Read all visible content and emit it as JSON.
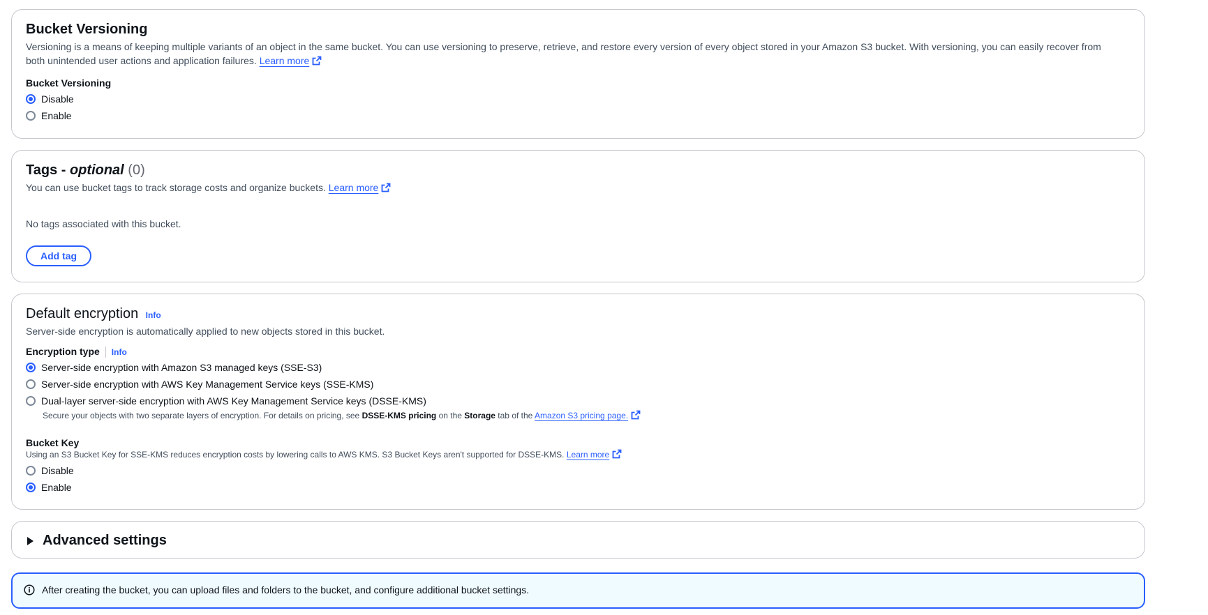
{
  "colors": {
    "accent": "#295eff",
    "border": "#c6c6cd",
    "info_bg": "#f0fbff"
  },
  "versioning": {
    "title": "Bucket Versioning",
    "description_line1": "Versioning is a means of keeping multiple variants of an object in the same bucket. You can use versioning to preserve, retrieve, and restore every version of every object stored in your Amazon S3 bucket. With versioning, you can easily recover from",
    "description_line2": "both unintended user actions and application failures.",
    "learn_more": "Learn more",
    "field_label": "Bucket Versioning",
    "options": [
      {
        "label": "Disable",
        "selected": true
      },
      {
        "label": "Enable",
        "selected": false
      }
    ]
  },
  "tags": {
    "title_prefix": "Tags - ",
    "title_optional": "optional",
    "count": "(0)",
    "description": "You can use bucket tags to track storage costs and organize buckets.",
    "learn_more": "Learn more",
    "empty_text": "No tags associated with this bucket.",
    "add_button": "Add tag"
  },
  "encryption": {
    "title": "Default encryption",
    "info": "Info",
    "description": "Server-side encryption is automatically applied to new objects stored in this bucket.",
    "type_label": "Encryption type",
    "type_info": "Info",
    "options": [
      {
        "label": "Server-side encryption with Amazon S3 managed keys (SSE-S3)",
        "selected": true
      },
      {
        "label": "Server-side encryption with AWS Key Management Service keys (SSE-KMS)",
        "selected": false
      },
      {
        "label": "Dual-layer server-side encryption with AWS Key Management Service keys (DSSE-KMS)",
        "selected": false
      }
    ],
    "dsse_note_1": "Secure your objects with two separate layers of encryption. For details on pricing, see ",
    "dsse_note_bold1": "DSSE-KMS pricing",
    "dsse_note_2": " on the ",
    "dsse_note_bold2": "Storage",
    "dsse_note_3": " tab of the ",
    "dsse_note_link": "Amazon S3 pricing page.",
    "bucket_key_label": "Bucket Key",
    "bucket_key_desc": "Using an S3 Bucket Key for SSE-KMS reduces encryption costs by lowering calls to AWS KMS. S3 Bucket Keys aren't supported for DSSE-KMS.",
    "bucket_key_learn_more": "Learn more",
    "bucket_key_options": [
      {
        "label": "Disable",
        "selected": false
      },
      {
        "label": "Enable",
        "selected": true
      }
    ]
  },
  "advanced": {
    "title": "Advanced settings",
    "expanded": false
  },
  "alert": {
    "text": "After creating the bucket, you can upload files and folders to the bucket, and configure additional bucket settings."
  }
}
